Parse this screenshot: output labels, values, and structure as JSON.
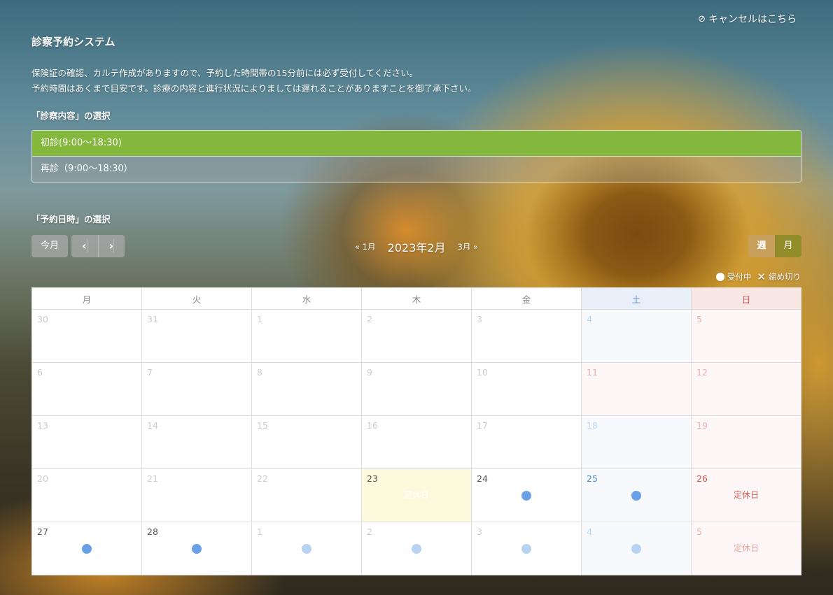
{
  "header": {
    "cancel_label": "キャンセルはこちら",
    "title": "診察予約システム"
  },
  "notice": {
    "line1": "保険証の確認、カルテ作成がありますので、予約した時間帯の15分前には必ず受付してください。",
    "line2": "予約時間はあくまで目安です。診療の内容と進行状況によりましては遅れることがありますことを御了承下さい。"
  },
  "menu_section": {
    "title": "「診察内容」の選択",
    "items": [
      {
        "label": "初診(9:00〜18:30)",
        "selected": true
      },
      {
        "label": "再診（9:00〜18:30）",
        "selected": false
      }
    ]
  },
  "date_section": {
    "title": "「予約日時」の選択"
  },
  "toolbar": {
    "today_label": "今月",
    "prev_icon": "chevron-left-icon",
    "next_icon": "chevron-right-icon",
    "prev_month": "1月",
    "current_month": "2023年2月",
    "next_month": "3月",
    "view_week": "週",
    "view_month": "月"
  },
  "legend": {
    "open_label": "受付中",
    "closed_label": "締め切り"
  },
  "calendar": {
    "weekdays": [
      "月",
      "火",
      "水",
      "木",
      "金",
      "土",
      "日"
    ],
    "weeks": [
      [
        {
          "day": "30",
          "status": ""
        },
        {
          "day": "31",
          "status": ""
        },
        {
          "day": "1",
          "status": ""
        },
        {
          "day": "2",
          "status": ""
        },
        {
          "day": "3",
          "status": ""
        },
        {
          "day": "4",
          "status": ""
        },
        {
          "day": "5",
          "status": ""
        }
      ],
      [
        {
          "day": "6",
          "status": ""
        },
        {
          "day": "7",
          "status": ""
        },
        {
          "day": "8",
          "status": ""
        },
        {
          "day": "9",
          "status": ""
        },
        {
          "day": "10",
          "status": ""
        },
        {
          "day": "11",
          "status": ""
        },
        {
          "day": "12",
          "status": ""
        }
      ],
      [
        {
          "day": "13",
          "status": ""
        },
        {
          "day": "14",
          "status": ""
        },
        {
          "day": "15",
          "status": ""
        },
        {
          "day": "16",
          "status": ""
        },
        {
          "day": "17",
          "status": ""
        },
        {
          "day": "18",
          "status": ""
        },
        {
          "day": "19",
          "status": ""
        }
      ],
      [
        {
          "day": "20",
          "status": ""
        },
        {
          "day": "21",
          "status": ""
        },
        {
          "day": "22",
          "status": ""
        },
        {
          "day": "23",
          "status": "定休日"
        },
        {
          "day": "24",
          "status": "open"
        },
        {
          "day": "25",
          "status": "open"
        },
        {
          "day": "26",
          "status": "定休日"
        }
      ],
      [
        {
          "day": "27",
          "status": "open"
        },
        {
          "day": "28",
          "status": "open"
        },
        {
          "day": "1",
          "status": "open"
        },
        {
          "day": "2",
          "status": "open"
        },
        {
          "day": "3",
          "status": "open"
        },
        {
          "day": "4",
          "status": "open"
        },
        {
          "day": "5",
          "status": "定休日"
        }
      ]
    ]
  }
}
